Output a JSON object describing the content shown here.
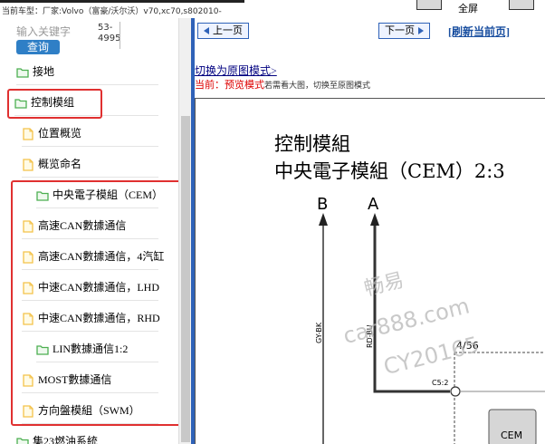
{
  "topbar": {
    "info": "当前车型：厂家:Volvo（富豪/沃尔沃）v70,xc70,s802010-",
    "bl_label": "全屏"
  },
  "search": {
    "placeholder": "输入关键字",
    "button_label": "查询",
    "vin_text": "53-4995"
  },
  "tree": {
    "items": [
      {
        "label": "接地",
        "type": "folder"
      },
      {
        "label": "控制模组",
        "type": "folder-open"
      },
      {
        "label": "位置概览",
        "type": "doc"
      },
      {
        "label": "概览命名",
        "type": "doc"
      },
      {
        "label": "中央電子模組（CEM）",
        "type": "folder"
      },
      {
        "label": "高速CAN數據通信",
        "type": "doc"
      },
      {
        "label": "高速CAN數據通信，4汽缸",
        "type": "doc"
      },
      {
        "label": "中速CAN數據通信，LHD",
        "type": "doc"
      },
      {
        "label": "中速CAN數據通信，RHD",
        "type": "doc"
      },
      {
        "label": "LIN數據通信1:2",
        "type": "folder"
      },
      {
        "label": "MOST數據通信",
        "type": "doc"
      },
      {
        "label": "方向盤模組（SWM）",
        "type": "doc"
      },
      {
        "label": "集23燃油系統",
        "type": "folder"
      }
    ]
  },
  "nav": {
    "prev_label": "上一页",
    "next_label": "下一页",
    "refresh_label": "[刷新当前页]"
  },
  "preview": {
    "switch_link": "切换为原图模式>",
    "current_prefix": "当前：",
    "current_mode": "预览模式",
    "current_hint": "若需看大图，切换至原图模式"
  },
  "diagram": {
    "title_line1": "控制模組",
    "title_line2": "中央電子模組（CEM）2:3",
    "pin_b": "B",
    "pin_a": "A",
    "wire_b": "GY-BK",
    "wire_a": "RD-BU",
    "connector": "C5:2",
    "fraction": "4/56",
    "module": "CEM",
    "watermark_1": "畅易",
    "watermark_2": "car888.com",
    "watermark_3": "CY20165"
  },
  "colors": {
    "accent_blue": "#2f62b8",
    "highlight_red": "#e03030",
    "folder_green": "#4caf50",
    "doc_yellow": "#f3c24a"
  }
}
